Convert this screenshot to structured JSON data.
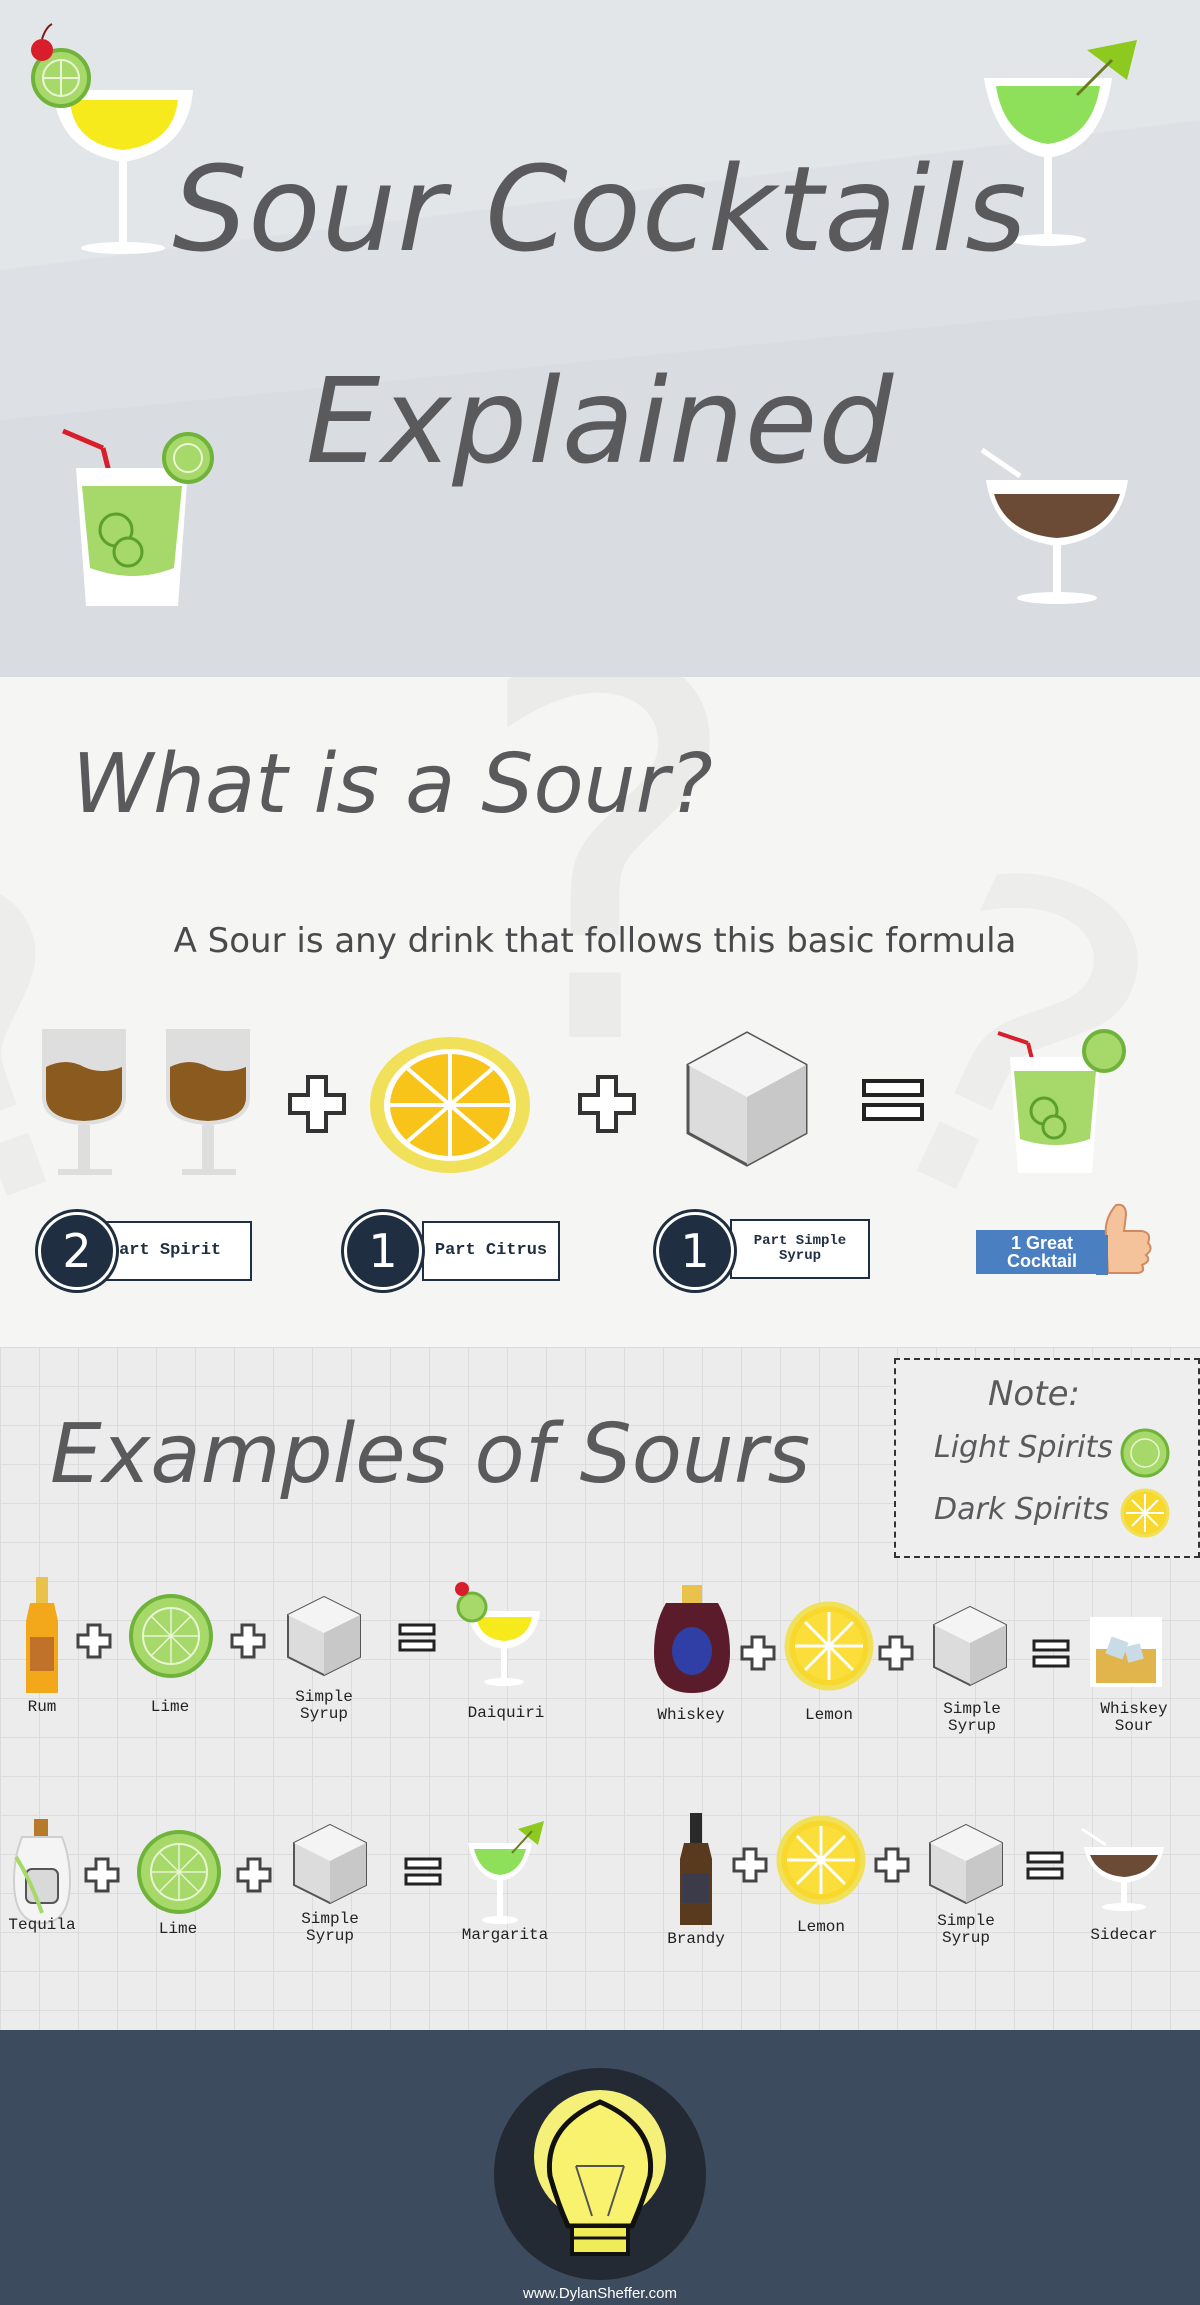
{
  "header": {
    "title_line1": "Sour Cocktails",
    "title_line2": "Explained"
  },
  "what_section": {
    "heading": "What is a Sour?",
    "subtitle": "A Sour is any drink that follows this basic formula",
    "badges": [
      {
        "number": "2",
        "label": "Part Spirit"
      },
      {
        "number": "1",
        "label": "Part Citrus"
      },
      {
        "number": "1",
        "label": "Part Simple Syrup"
      }
    ],
    "result_label": "1 Great Cocktail"
  },
  "examples_section": {
    "heading": "Examples of Sours",
    "note": {
      "title": "Note:",
      "light": "Light Spirits =",
      "dark": "Dark Spirits ="
    },
    "recipes": [
      {
        "spirit": "Rum",
        "citrus": "Lime",
        "sweetener": "Simple Syrup",
        "result": "Daiquiri"
      },
      {
        "spirit": "Whiskey",
        "citrus": "Lemon",
        "sweetener": "Simple Syrup",
        "result": "Whiskey Sour"
      },
      {
        "spirit": "Tequila",
        "citrus": "Lime",
        "sweetener": "Simple Syrup",
        "result": "Margarita"
      },
      {
        "spirit": "Brandy",
        "citrus": "Lemon",
        "sweetener": "Simple Syrup",
        "result": "Sidecar"
      }
    ]
  },
  "footer": {
    "url": "www.DylanSheffer.com"
  },
  "colors": {
    "header_bg": "#dde1e5",
    "section_bg": "#f5f5f4",
    "grid_bg": "#ececec",
    "footer_bg": "#3c4b5d",
    "navy": "#1f2e40",
    "lime": "#a6d86a",
    "lemon": "#f8d82c",
    "brown": "#8a5a1e",
    "badge_blue": "#4a7fc1"
  }
}
